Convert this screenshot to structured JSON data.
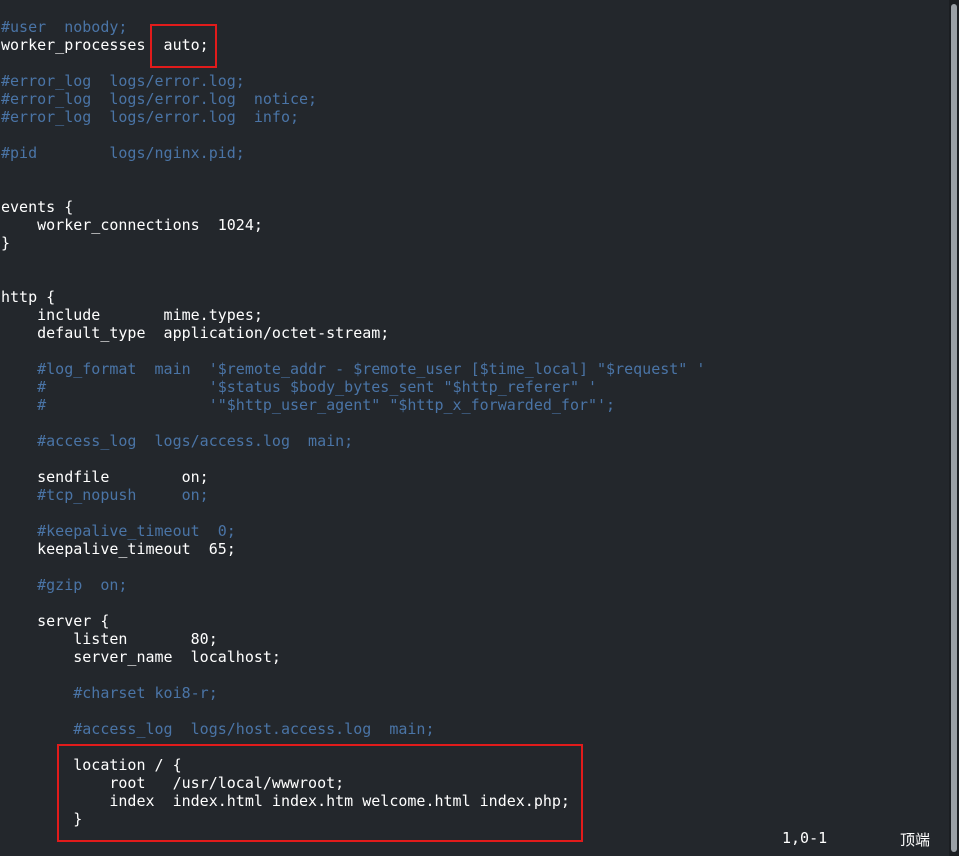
{
  "editor": {
    "lines": [
      {
        "text": "#user  nobody;",
        "kind": "comment"
      },
      {
        "text": "worker_processes  auto;",
        "kind": "normal"
      },
      {
        "text": "",
        "kind": "normal"
      },
      {
        "text": "#error_log  logs/error.log;",
        "kind": "comment"
      },
      {
        "text": "#error_log  logs/error.log  notice;",
        "kind": "comment"
      },
      {
        "text": "#error_log  logs/error.log  info;",
        "kind": "comment"
      },
      {
        "text": "",
        "kind": "normal"
      },
      {
        "text": "#pid        logs/nginx.pid;",
        "kind": "comment"
      },
      {
        "text": "",
        "kind": "normal"
      },
      {
        "text": "",
        "kind": "normal"
      },
      {
        "text": "events {",
        "kind": "normal"
      },
      {
        "text": "    worker_connections  1024;",
        "kind": "normal"
      },
      {
        "text": "}",
        "kind": "normal"
      },
      {
        "text": "",
        "kind": "normal"
      },
      {
        "text": "",
        "kind": "normal"
      },
      {
        "text": "http {",
        "kind": "normal"
      },
      {
        "text": "    include       mime.types;",
        "kind": "normal"
      },
      {
        "text": "    default_type  application/octet-stream;",
        "kind": "normal"
      },
      {
        "text": "",
        "kind": "normal"
      },
      {
        "text": "    #log_format  main  '$remote_addr - $remote_user [$time_local] \"$request\" '",
        "kind": "comment"
      },
      {
        "text": "    #                  '$status $body_bytes_sent \"$http_referer\" '",
        "kind": "comment"
      },
      {
        "text": "    #                  '\"$http_user_agent\" \"$http_x_forwarded_for\"';",
        "kind": "comment"
      },
      {
        "text": "",
        "kind": "normal"
      },
      {
        "text": "    #access_log  logs/access.log  main;",
        "kind": "comment"
      },
      {
        "text": "",
        "kind": "normal"
      },
      {
        "text": "    sendfile        on;",
        "kind": "normal"
      },
      {
        "text": "    #tcp_nopush     on;",
        "kind": "comment"
      },
      {
        "text": "",
        "kind": "normal"
      },
      {
        "text": "    #keepalive_timeout  0;",
        "kind": "comment"
      },
      {
        "text": "    keepalive_timeout  65;",
        "kind": "normal"
      },
      {
        "text": "",
        "kind": "normal"
      },
      {
        "text": "    #gzip  on;",
        "kind": "comment"
      },
      {
        "text": "",
        "kind": "normal"
      },
      {
        "text": "    server {",
        "kind": "normal"
      },
      {
        "text": "        listen       80;",
        "kind": "normal"
      },
      {
        "text": "        server_name  localhost;",
        "kind": "normal"
      },
      {
        "text": "",
        "kind": "normal"
      },
      {
        "text": "        #charset koi8-r;",
        "kind": "comment"
      },
      {
        "text": "",
        "kind": "normal"
      },
      {
        "text": "        #access_log  logs/host.access.log  main;",
        "kind": "comment"
      },
      {
        "text": "",
        "kind": "normal"
      },
      {
        "text": "        location / {",
        "kind": "normal"
      },
      {
        "text": "            root   /usr/local/wwwroot;",
        "kind": "normal"
      },
      {
        "text": "            index  index.html index.htm welcome.html index.php;",
        "kind": "normal"
      },
      {
        "text": "        }",
        "kind": "normal"
      }
    ]
  },
  "status": {
    "position": "1,0-1",
    "scroll": "顶端"
  },
  "colors": {
    "background": "#23272c",
    "text": "#ffffff",
    "comment": "#4a74a6",
    "highlight": "#e11b1b"
  }
}
